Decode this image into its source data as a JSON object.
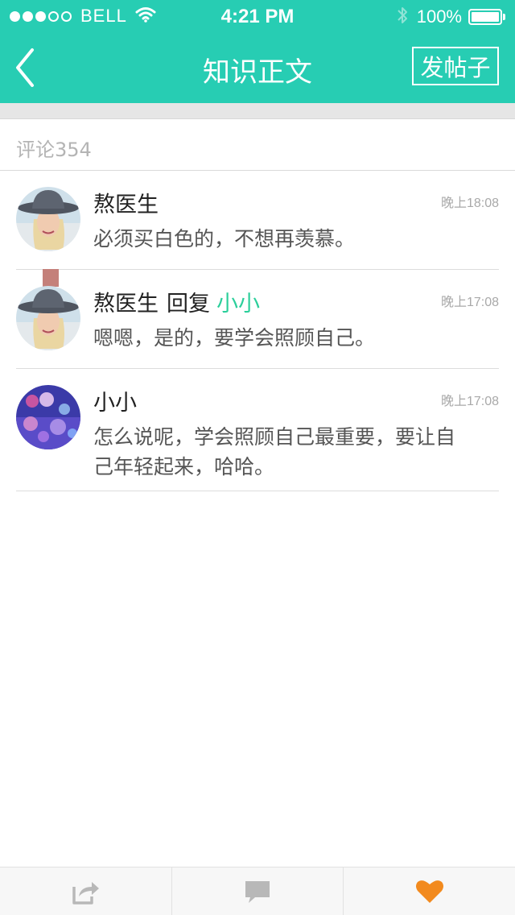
{
  "status_bar": {
    "carrier": "BELL",
    "time": "4:21 PM",
    "battery": "100%"
  },
  "nav": {
    "title": "知识正文",
    "post_button": "发帖子"
  },
  "comment_count": "评论354",
  "comments": [
    {
      "author": "熬医生",
      "reply_word": "",
      "reply_to": "",
      "time": "晚上18:08",
      "text": "必须买白色的，不想再羡慕。"
    },
    {
      "author": "熬医生",
      "reply_word": "回复",
      "reply_to": "小小",
      "time": "晚上17:08",
      "text": "嗯嗯，是的，要学会照顾自己。"
    },
    {
      "author": "小小",
      "reply_word": "",
      "reply_to": "",
      "time": "晚上17:08",
      "text": "怎么说呢，学会照顾自己最重要，要让自己年轻起来，哈哈。"
    }
  ],
  "icons": {
    "back": "chevron-left-icon",
    "wifi": "wifi-icon",
    "bluetooth": "bluetooth-icon",
    "share": "share-icon",
    "comment": "comment-icon",
    "like": "heart-icon"
  },
  "colors": {
    "accent": "#27cdb3",
    "reply_name": "#2ccf9b",
    "like": "#f28a1e"
  }
}
